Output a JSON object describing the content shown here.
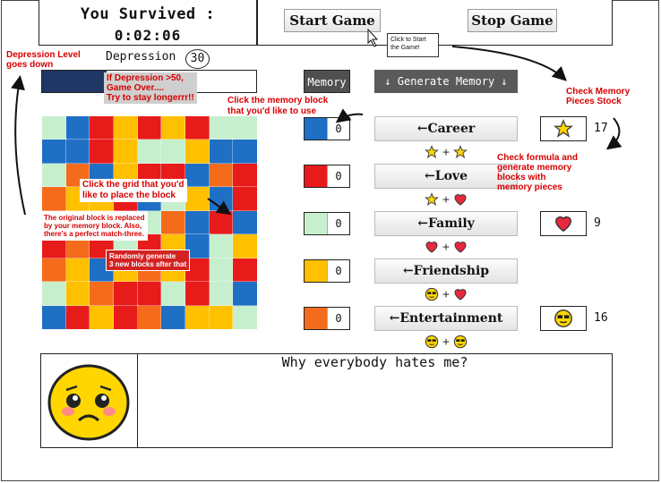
{
  "status": {
    "line1": "You Survived :",
    "time": "0:02:06"
  },
  "controls": {
    "start": "Start Game",
    "stop": "Stop Game",
    "start_tip": "Click to Start the Game!"
  },
  "depression": {
    "label": "Depression",
    "value": "30",
    "bar_fraction": 0.3
  },
  "buttons": {
    "memory": "Memory",
    "generate": "↓ Generate Memory ↓"
  },
  "grid_colors": {
    "Y": "#ffc000",
    "B": "#1f6fc5",
    "R": "#e81b1b",
    "O": "#f36b1b",
    "G": "#c6efce"
  },
  "grid": [
    "GBRYRYRG",
    "BBRYGGYBB",
    "GOBYRRBOR",
    "OYYRBGYBR",
    "RGRRGOBRB",
    "RORGRYBGY",
    "OYBYOYRGR",
    "GYORRGRGB",
    "BRYROBYYG"
  ],
  "memory_blocks": [
    {
      "color": "#1f6fc5",
      "count": "0"
    },
    {
      "color": "#e81b1b",
      "count": "0"
    },
    {
      "color": "#c6efce",
      "count": "0"
    },
    {
      "color": "#ffc000",
      "count": "0"
    },
    {
      "color": "#f36b1b",
      "count": "0"
    }
  ],
  "categories": [
    {
      "label": "←Career",
      "formula": [
        "star-icon",
        "star-icon"
      ]
    },
    {
      "label": "←Love",
      "formula": [
        "star-icon",
        "heart-icon"
      ]
    },
    {
      "label": "←Family",
      "formula": [
        "heart-icon",
        "heart-icon"
      ]
    },
    {
      "label": "←Friendship",
      "formula": [
        "cool-face-icon",
        "heart-icon"
      ]
    },
    {
      "label": "←Entertainment",
      "formula": [
        "cool-face-icon",
        "cool-face-icon"
      ]
    }
  ],
  "stocks": [
    {
      "icon": "star-icon",
      "count": "17"
    },
    {
      "icon": "heart-icon",
      "count": "9"
    },
    {
      "icon": "cool-face-icon",
      "count": "16"
    }
  ],
  "dialog": {
    "text": "Why everybody hates me?"
  },
  "annotations": {
    "dep_goes_down": "Depression Level\ngoes down",
    "game_over": "If Depression >50,\nGame Over....\nTry to stay longerrr!!",
    "click_memory": "Click the memory block\nthat you'd like to use",
    "check_stock": "Check Memory\nPieces Stock",
    "check_formula": "Check formula and\ngenerate memory\nblocks with\nmemory pieces",
    "click_grid": "Click the grid that you'd\nlike to place the block",
    "replaced": "The original block is replaced\nby your memory block. Also,\nthere's a perfect match-three.",
    "random": "Randomly generate\n3 new blocks after that"
  }
}
